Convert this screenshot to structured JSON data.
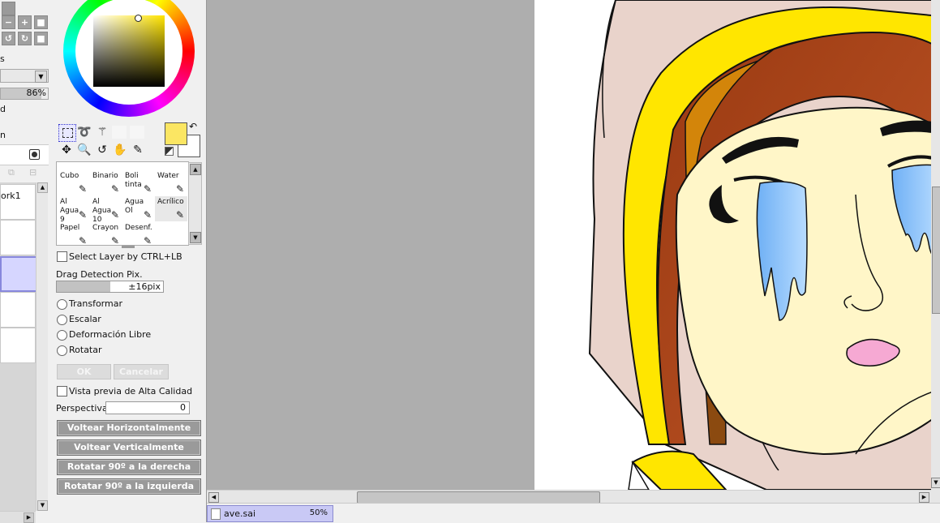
{
  "colors": {
    "primary": "#fbe663",
    "secondary": "#ffffff",
    "canvas_bg": "#aeaeae",
    "selected_layer": "#d6d6ff",
    "document_tab": "#c9c9f5"
  },
  "left_panel": {
    "opacity_value": "86%",
    "label_s": "s",
    "label_d": "d",
    "label_n": "n",
    "layer_name": "ork1"
  },
  "brushes": [
    {
      "label": "Cubo",
      "icon": "bucket-icon"
    },
    {
      "label": "Binario",
      "icon": "pencil-icon"
    },
    {
      "label": "Boli tinta",
      "icon": "ink-pen-icon"
    },
    {
      "label": "Water",
      "icon": "water-brush-icon"
    },
    {
      "label": "Al Agua 9",
      "icon": "brush-icon"
    },
    {
      "label": "Al Agua 10",
      "icon": "brush-icon"
    },
    {
      "label": "Agua Ol",
      "icon": "brush-icon"
    },
    {
      "label": "Acrílico",
      "icon": "brush-icon"
    },
    {
      "label": "Papel",
      "icon": "brush-icon"
    },
    {
      "label": "Crayon",
      "icon": "brush-icon"
    },
    {
      "label": "Desenf.",
      "icon": "brush-icon"
    }
  ],
  "tool_options": {
    "select_layer": "Select Layer by CTRL+LB",
    "drag_label": "Drag Detection Pix.",
    "drag_value": "±16pix",
    "drag_fill_fraction": 0.5,
    "radios": [
      "Transformar",
      "Escalar",
      "Deformación Libre",
      "Rotatar"
    ],
    "ok": "OK",
    "cancel": "Cancelar",
    "hq_preview": "Vista previa de Alta Calidad",
    "perspective_label": "Perspectiva",
    "perspective_value": "0",
    "actions": [
      "Voltear Horizontalmente",
      "Voltear Verticalmente",
      "Rotatar 90º a la derecha",
      "Rotatar 90º a la izquierda"
    ]
  },
  "document": {
    "name": "ave.sai",
    "zoom": "50%"
  }
}
